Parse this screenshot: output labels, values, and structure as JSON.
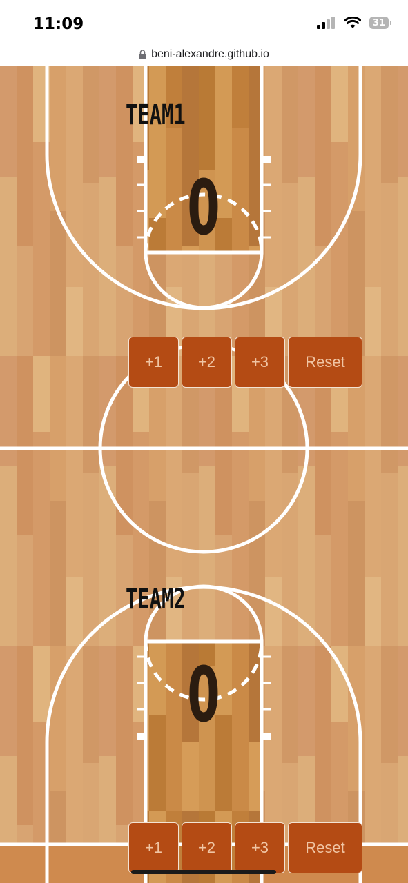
{
  "status_bar": {
    "time": "11:09",
    "battery_level": "31",
    "signal_icon": "cellular-signal-icon",
    "wifi_icon": "wifi-icon"
  },
  "browser": {
    "url": "beni-alexandre.github.io",
    "lock_icon": "lock-icon"
  },
  "teams": [
    {
      "name": "TEAM1",
      "score": "0"
    },
    {
      "name": "TEAM2",
      "score": "0"
    }
  ],
  "controls": {
    "plus_one_label": "+1",
    "plus_two_label": "+2",
    "plus_three_label": "+3",
    "reset_label": "Reset"
  },
  "colors": {
    "button_bg": "#b44b14",
    "button_text": "#f0c5a4",
    "court_wood": "#d9a06c",
    "paint_wood": "#c98a45",
    "court_lines": "#ffffff",
    "score_text": "#2b1c10"
  }
}
